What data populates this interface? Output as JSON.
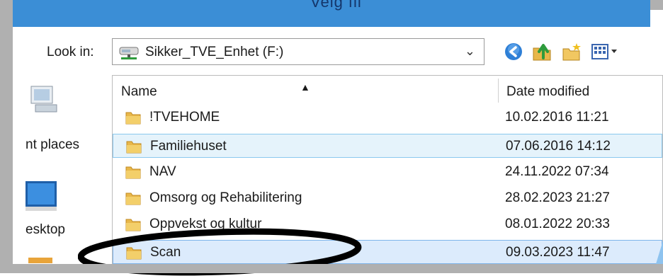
{
  "window": {
    "title": "Velg fil"
  },
  "toolbar": {
    "look_in_label": "Look in:",
    "look_in_value": "Sikker_TVE_Enhet (F:)",
    "icons": [
      "back-icon",
      "up-folder-icon",
      "new-folder-icon",
      "view-menu-icon"
    ]
  },
  "places": {
    "items": [
      {
        "label": "nt places",
        "icon": "recent-places-icon"
      },
      {
        "label": "esktop",
        "icon": "desktop-icon"
      }
    ]
  },
  "file_list": {
    "columns": {
      "name": "Name",
      "date_modified": "Date modified"
    },
    "rows": [
      {
        "name": "!TVEHOME",
        "date": "10.02.2016 11:21",
        "state": "normal"
      },
      {
        "name": "Familiehuset",
        "date": "07.06.2016 14:12",
        "state": "hover"
      },
      {
        "name": "NAV",
        "date": "24.11.2022 07:34",
        "state": "normal"
      },
      {
        "name": "Omsorg og Rehabilitering",
        "date": "28.02.2023 21:27",
        "state": "normal"
      },
      {
        "name": "Oppvekst og kultur",
        "date": "08.01.2022 20:33",
        "state": "normal"
      },
      {
        "name": "Scan",
        "date": "09.03.2023 11:47",
        "state": "selected"
      }
    ]
  },
  "colors": {
    "selection": "#dcebfc",
    "hover": "#e5f3fb",
    "title_strip": "#3b8ed6",
    "folder": "#e8b74a"
  }
}
